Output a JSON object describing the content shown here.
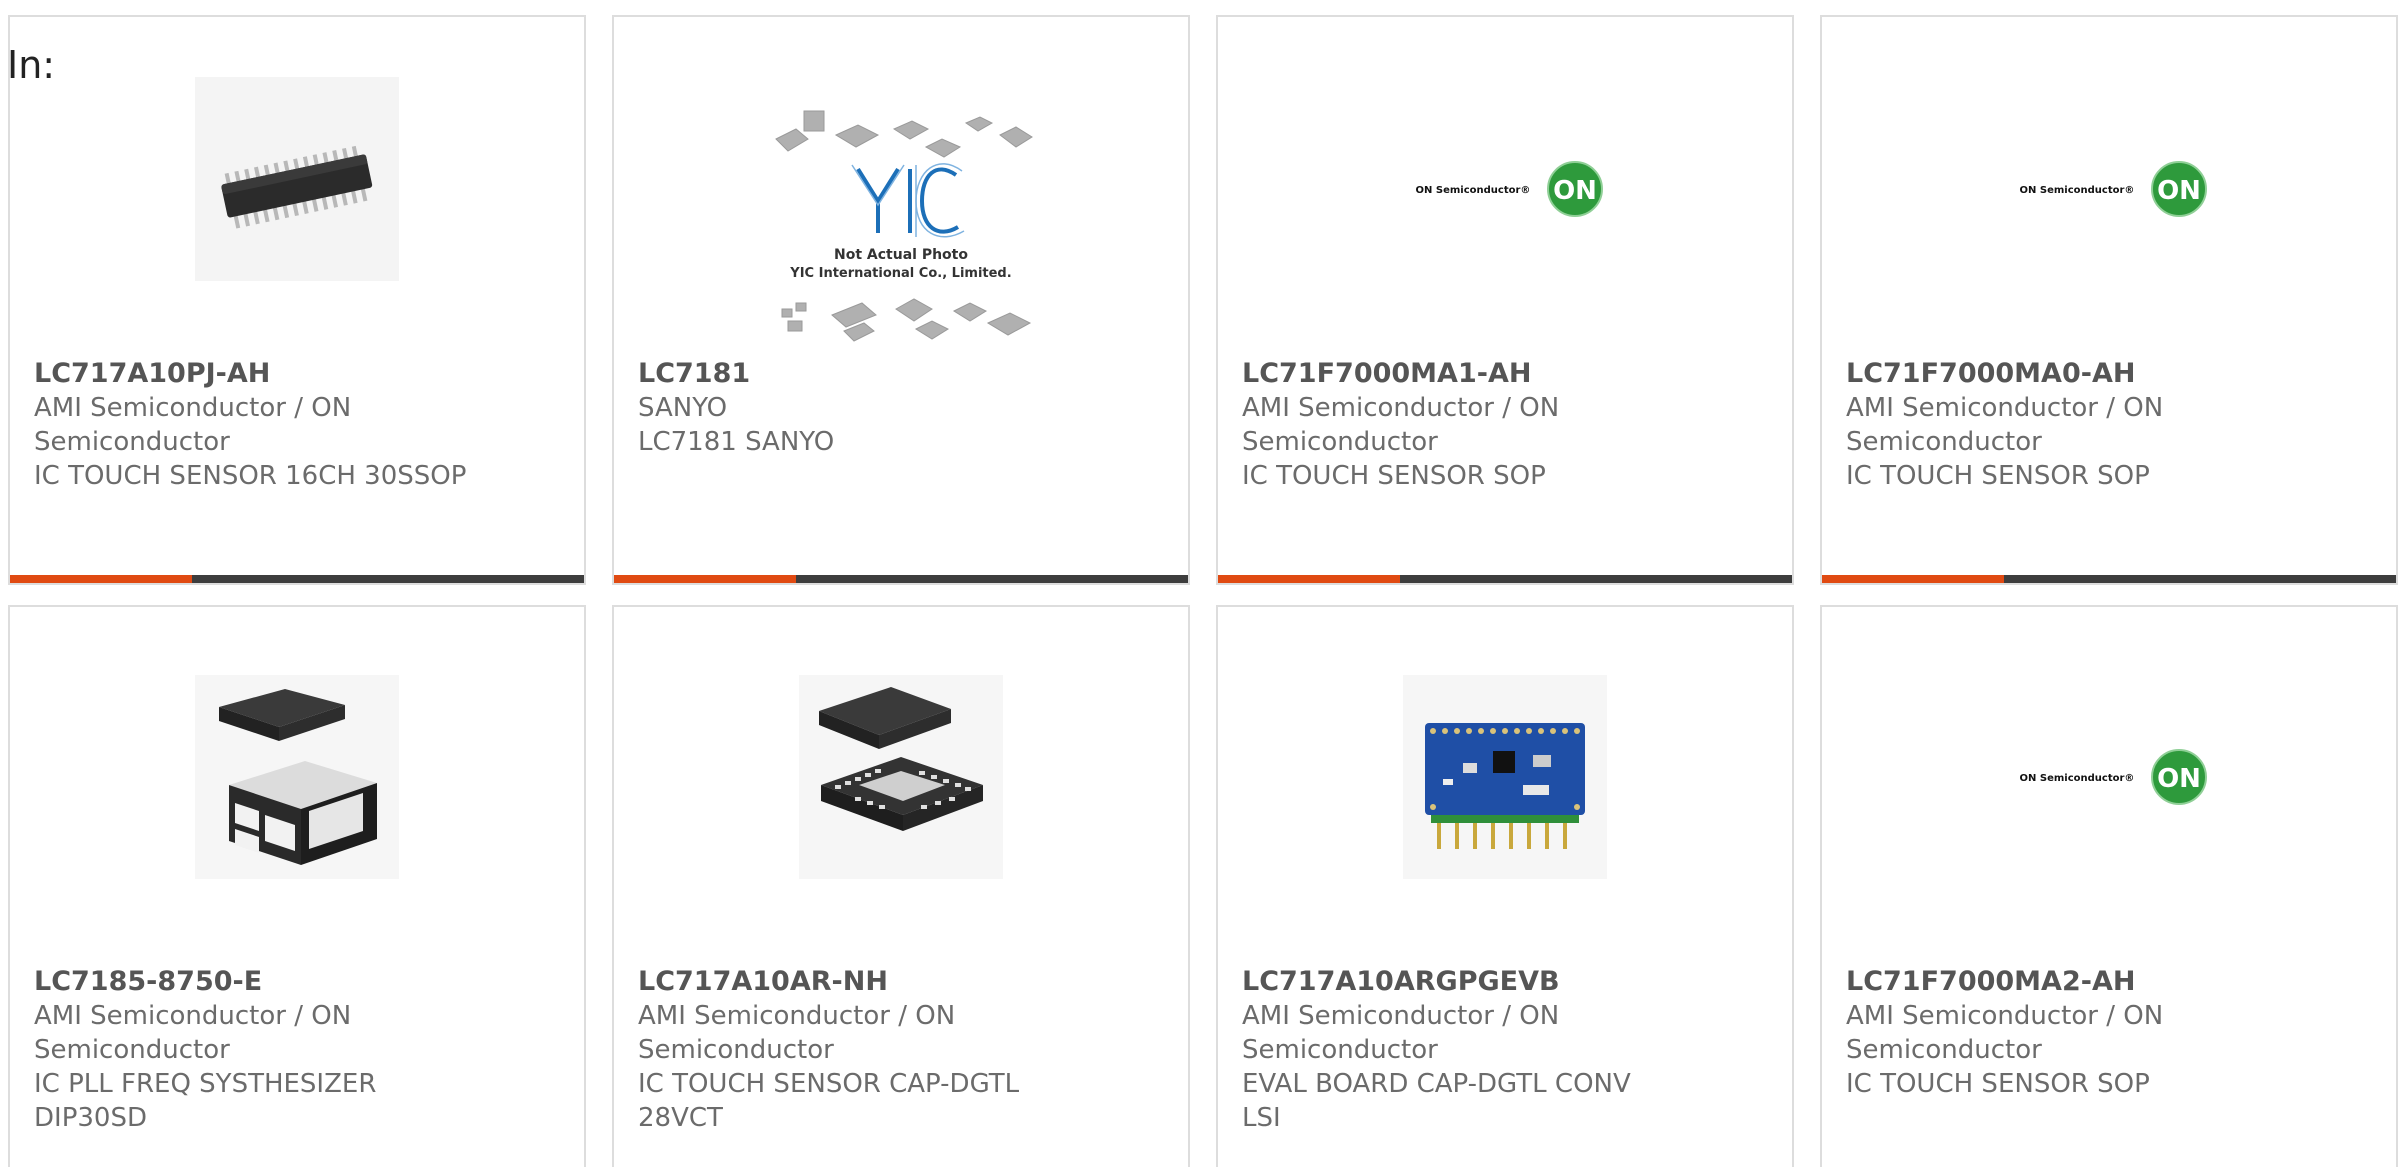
{
  "header": {
    "in_label": "In:"
  },
  "products": [
    {
      "part": "LC717A10PJ-AH",
      "manufacturer_line1": "AMI Semiconductor / ON",
      "manufacturer_line2": "Semiconductor",
      "desc_line1": "IC TOUCH SENSOR 16CH 30SSOP",
      "desc_line2": "",
      "image": "ssop-chip-icon"
    },
    {
      "part": "LC7181",
      "manufacturer_line1": "SANYO",
      "manufacturer_line2": "LC7181 SANYO",
      "desc_line1": "",
      "desc_line2": "",
      "image": "yic-placeholder-image",
      "placeholder": {
        "logo": "YIC",
        "note1": "Not Actual Photo",
        "note2": "YIC International Co., Limited."
      }
    },
    {
      "part": "LC71F7000MA1-AH",
      "manufacturer_line1": "AMI Semiconductor / ON",
      "manufacturer_line2": "Semiconductor",
      "desc_line1": "IC TOUCH SENSOR SOP",
      "desc_line2": "",
      "image": "on-semiconductor-logo",
      "logo": {
        "text": "ON Semiconductor®",
        "badge": "ON"
      }
    },
    {
      "part": "LC71F7000MA0-AH",
      "manufacturer_line1": "AMI Semiconductor / ON",
      "manufacturer_line2": "Semiconductor",
      "desc_line1": "IC TOUCH SENSOR SOP",
      "desc_line2": "",
      "image": "on-semiconductor-logo",
      "logo": {
        "text": "ON Semiconductor®",
        "badge": "ON"
      }
    },
    {
      "part": "LC7185-8750-E",
      "manufacturer_line1": "AMI Semiconductor / ON",
      "manufacturer_line2": "Semiconductor",
      "desc_line1": "IC PLL FREQ SYSTHESIZER",
      "desc_line2": "DIP30SD",
      "image": "dfn-chip-icon"
    },
    {
      "part": "LC717A10AR-NH",
      "manufacturer_line1": "AMI Semiconductor / ON",
      "manufacturer_line2": "Semiconductor",
      "desc_line1": "IC TOUCH SENSOR CAP-DGTL",
      "desc_line2": "28VCT",
      "image": "qfn-chip-icon"
    },
    {
      "part": "LC717A10ARGPGEVB",
      "manufacturer_line1": "AMI Semiconductor / ON",
      "manufacturer_line2": "Semiconductor",
      "desc_line1": "EVAL BOARD CAP-DGTL CONV",
      "desc_line2": "LSI",
      "image": "eval-board-icon"
    },
    {
      "part": "LC71F7000MA2-AH",
      "manufacturer_line1": "AMI Semiconductor / ON",
      "manufacturer_line2": "Semiconductor",
      "desc_line1": "IC TOUCH SENSOR SOP",
      "desc_line2": "",
      "image": "on-semiconductor-logo",
      "logo": {
        "text": "ON Semiconductor®",
        "badge": "ON"
      }
    }
  ],
  "colors": {
    "accent": "#e04a12",
    "bar": "#3d3d3d",
    "on_green": "#2e9a3c",
    "yic_blue": "#1c6fb8",
    "board_blue": "#1f4fa6"
  }
}
